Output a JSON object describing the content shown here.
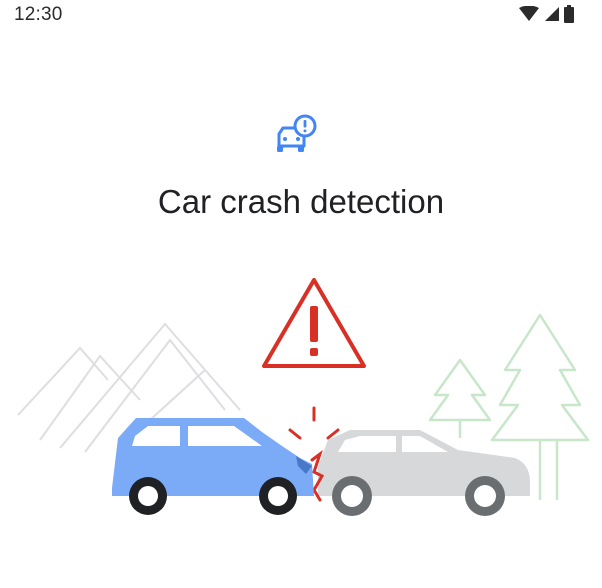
{
  "status_bar": {
    "time": "12:30",
    "icons": [
      "wifi-icon",
      "cellular-signal-icon",
      "battery-icon"
    ]
  },
  "screen": {
    "feature_icon": "car-crash-alert-icon",
    "title": "Car crash detection",
    "illustration": "car-crash-illustration"
  },
  "colors": {
    "accent_blue": "#4285f4",
    "car_blue": "#7baaf7",
    "warning_red": "#d93025",
    "car_grey": "#d4d6d8",
    "tree_green": "#c8e6c9",
    "mountain_grey": "#dadce0"
  }
}
